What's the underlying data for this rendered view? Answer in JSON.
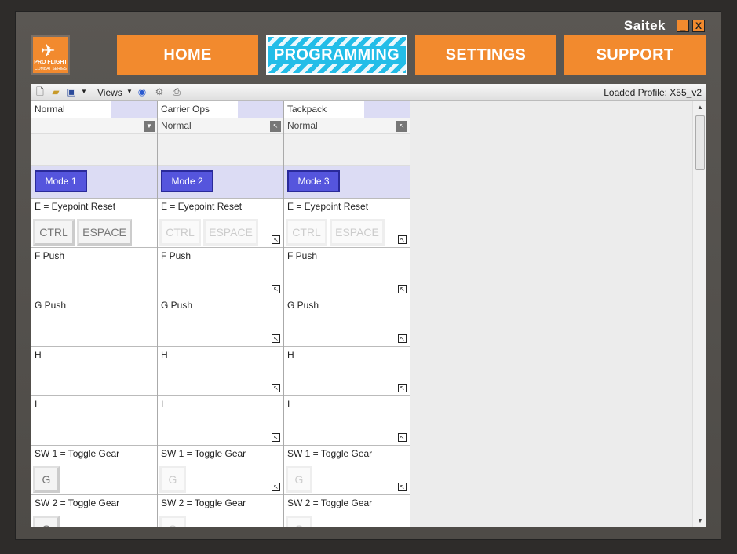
{
  "window": {
    "brand": "Saitek",
    "logo_text": "PRO FLIGHT",
    "logo_subtext": "COMBAT SERIES",
    "min_label": "_",
    "close_label": "X"
  },
  "nav": {
    "home": "HOME",
    "programming": "PROGRAMMING",
    "settings": "SETTINGS",
    "support": "SUPPORT"
  },
  "toolbar": {
    "views_label": "Views",
    "loaded_profile": "Loaded Profile: X55_v2"
  },
  "columns": [
    {
      "name": "Normal",
      "select": "",
      "mode": "Mode 1",
      "rows": [
        {
          "label": "E = Eyepoint Reset",
          "keys": [
            "CTRL",
            "ESPACE"
          ]
        },
        {
          "label": "F Push"
        },
        {
          "label": "G Push"
        },
        {
          "label": "H"
        },
        {
          "label": "I"
        },
        {
          "label": "SW 1 = Toggle Gear",
          "key": "G"
        },
        {
          "label": "SW 2 = Toggle Gear",
          "key": "G"
        }
      ]
    },
    {
      "name": "Carrier Ops",
      "select": "Normal",
      "mode": "Mode 2",
      "rows": [
        {
          "label": "E = Eyepoint Reset",
          "keys": [
            "CTRL",
            "ESPACE"
          ]
        },
        {
          "label": "F Push"
        },
        {
          "label": "G Push"
        },
        {
          "label": "H"
        },
        {
          "label": "I"
        },
        {
          "label": "SW 1 = Toggle Gear",
          "key": "G"
        },
        {
          "label": "SW 2 = Toggle Gear",
          "key": "G"
        }
      ]
    },
    {
      "name": "Tackpack",
      "select": "Normal",
      "mode": "Mode 3",
      "rows": [
        {
          "label": "E = Eyepoint Reset",
          "keys": [
            "CTRL",
            "ESPACE"
          ]
        },
        {
          "label": "F Push"
        },
        {
          "label": "G Push"
        },
        {
          "label": "H"
        },
        {
          "label": "I"
        },
        {
          "label": "SW 1 = Toggle Gear",
          "key": "G"
        },
        {
          "label": "SW 2 = Toggle Gear",
          "key": "G"
        }
      ]
    }
  ]
}
